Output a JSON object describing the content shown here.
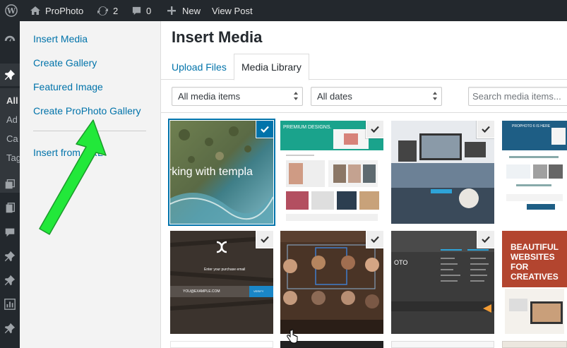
{
  "adminbar": {
    "site_name": "ProPhoto",
    "updates_count": "2",
    "comments_count": "0",
    "new_label": "New",
    "view_post_label": "View Post"
  },
  "adminmenu": {
    "partial_labels": [
      "All",
      "Ad",
      "Ca",
      "Tag"
    ]
  },
  "modal": {
    "menu": {
      "items": [
        "Insert Media",
        "Create Gallery",
        "Featured Image",
        "Create ProPhoto Gallery"
      ],
      "insert_from_url": "Insert from URL"
    },
    "title": "Insert Media",
    "tabs": [
      "Upload Files",
      "Media Library"
    ],
    "active_tab": "Media Library",
    "filters": {
      "type": "All media items",
      "date": "All dates"
    },
    "search": {
      "placeholder": "Search media items..."
    },
    "thumbnails": [
      {
        "label": "orking with templa",
        "selected": true
      },
      {
        "label": "PREMIUM DESIGNS.",
        "selected": false
      },
      {
        "label": "",
        "selected": false
      },
      {
        "label": "PROPHOTO 6 IS HERE",
        "selected": false
      },
      {
        "label": "Enter your purchase email",
        "input_placeholder": "YOU@EXAMPLE.COM",
        "button_label": "VERIFY",
        "selected": false
      },
      {
        "label": "",
        "selected": false
      },
      {
        "label": "OTO",
        "selected": false
      },
      {
        "label": "BEAUTIFUL WEBSITES FOR CREATIVES",
        "selected": false
      }
    ]
  },
  "colors": {
    "admin_bar_bg": "#23282d",
    "link_blue": "#0073aa",
    "arrow_green": "#22e83a"
  }
}
